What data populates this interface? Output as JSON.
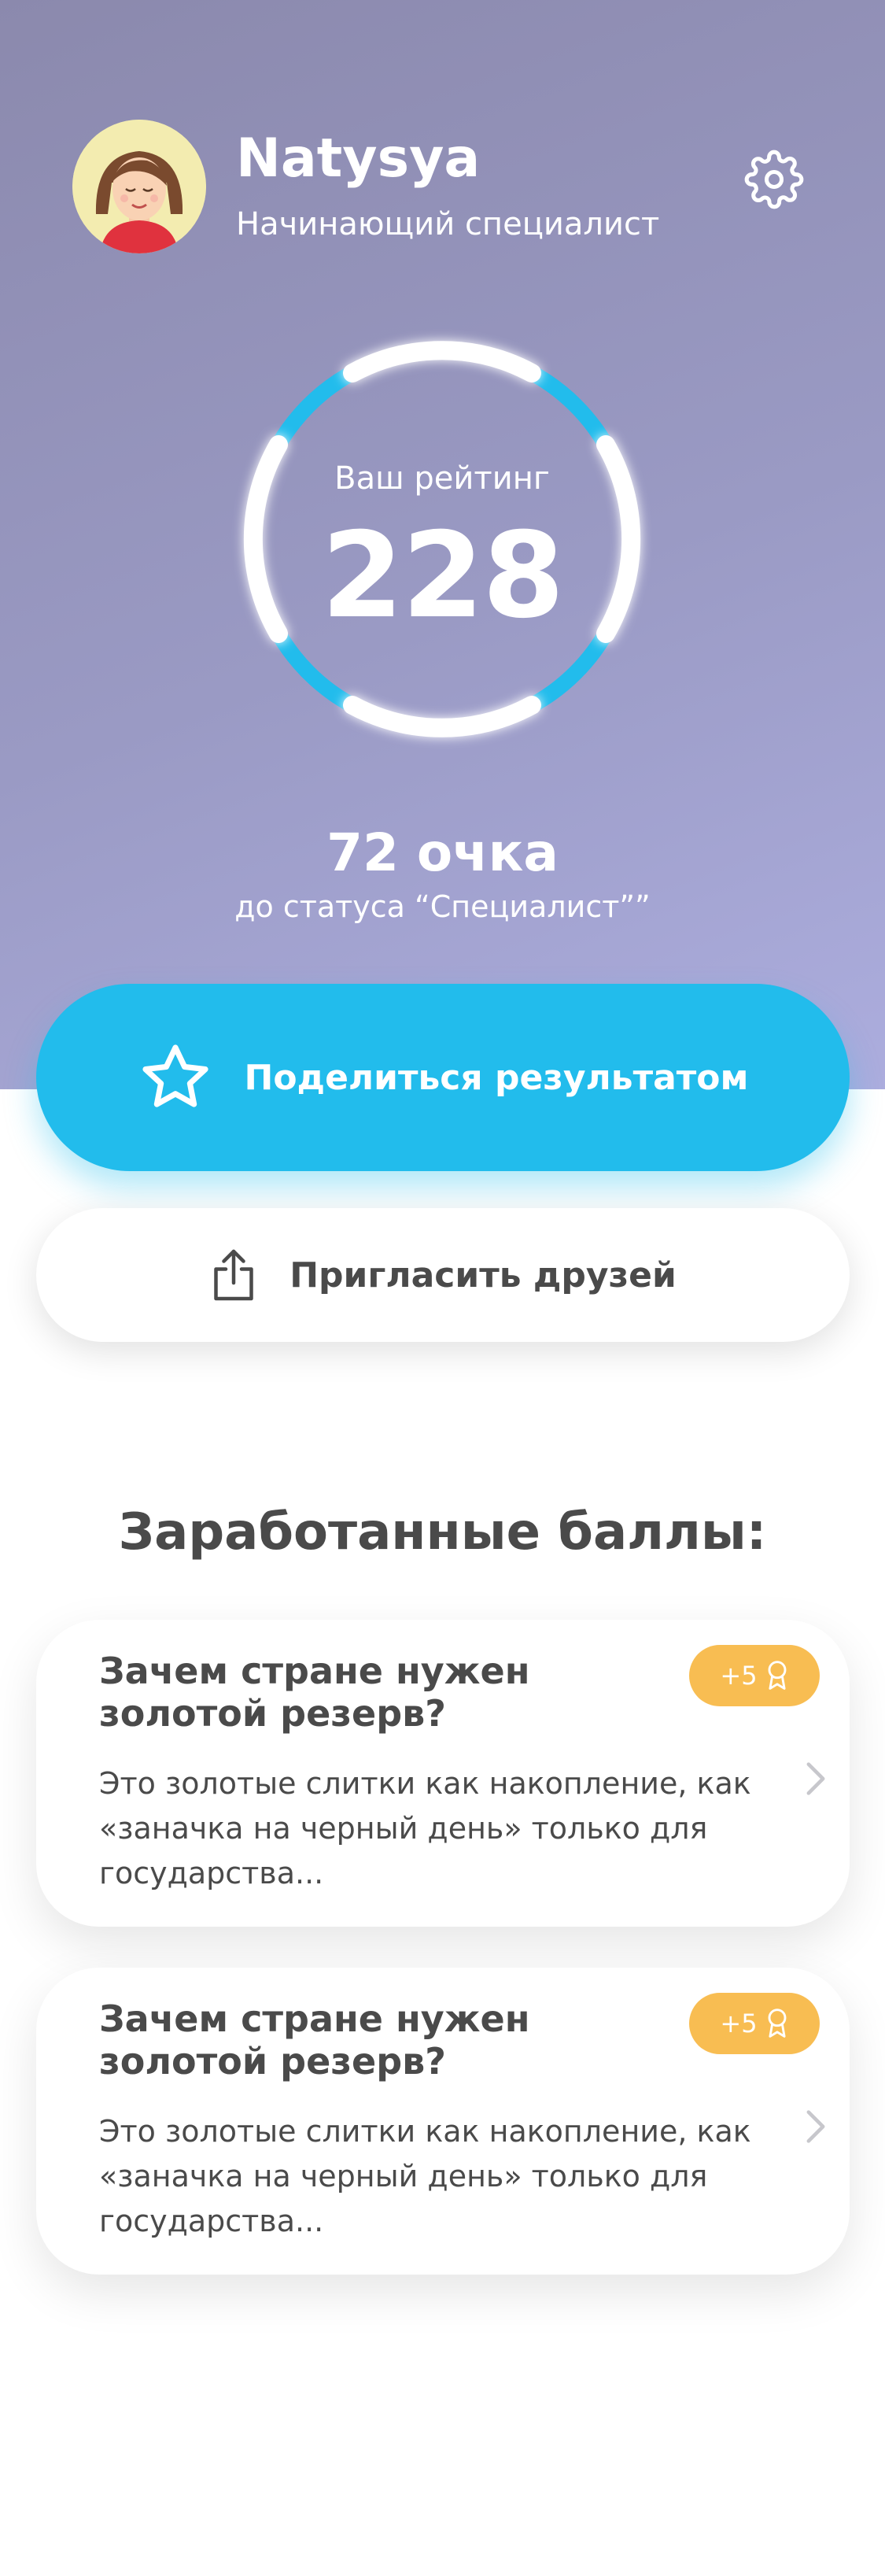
{
  "profile": {
    "name": "Natysya",
    "status": "Начинающий специалист"
  },
  "rating": {
    "label": "Ваш рейтинг",
    "value": "228"
  },
  "progress": {
    "points": "72 очка",
    "note": "до статуса “Специалист””"
  },
  "actions": {
    "share_label": "Поделиться результатом",
    "invite_label": "Пригласить друзей"
  },
  "earned": {
    "title": "Заработанные баллы:",
    "items": [
      {
        "title": "Зачем стране нужен золотой резерв?",
        "text": "Это золотые слитки как накопление, как «заначка на черный день» только для государства...",
        "badge": "+5"
      },
      {
        "title": "Зачем стране нужен золотой резерв?",
        "text": "Это золотые слитки как накопление, как «заначка на черный день» только для государства...",
        "badge": "+5"
      }
    ]
  },
  "colors": {
    "accent": "#22bcec",
    "badge": "#f8bd52",
    "text": "#4a4a4a",
    "hero_start": "#8b89ad",
    "hero_end": "#acadde"
  },
  "icons": {
    "settings": "gear-icon",
    "share": "star-icon",
    "invite": "share-upload-icon",
    "badge": "award-ribbon-icon",
    "card_arrow": "chevron-right-icon"
  }
}
